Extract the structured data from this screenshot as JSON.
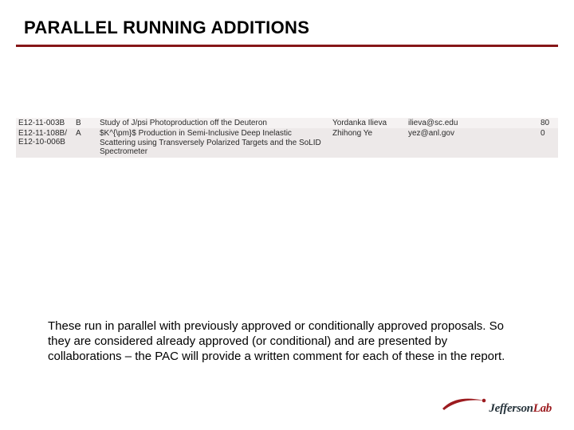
{
  "title": "PARALLEL RUNNING ADDITIONS",
  "table": {
    "rows": [
      {
        "experiment": "E12-11-003B",
        "rating": "B",
        "project_title": "Study of J/psi Photoproduction off the Deuteron",
        "contact_name": "Yordanka Ilieva",
        "contact_email": "ilieva@sc.edu",
        "number": "80"
      },
      {
        "experiment": "E12-11-108B/ E12-10-006B",
        "rating": "A",
        "project_title": "$K^{\\pm}$ Production in Semi-Inclusive Deep Inelastic Scattering using Transversely Polarized Targets and the SoLID Spectrometer",
        "contact_name": "Zhihong Ye",
        "contact_email": "yez@anl.gov",
        "number": "0"
      }
    ]
  },
  "body_text": "These run in parallel with previously approved or conditionally approved proposals. So they are considered already approved (or conditional)  and are presented by collaborations – the PAC will provide a written comment for each of these  in the report.",
  "logo": {
    "word1": "Jefferson",
    "word2": "Lab"
  }
}
